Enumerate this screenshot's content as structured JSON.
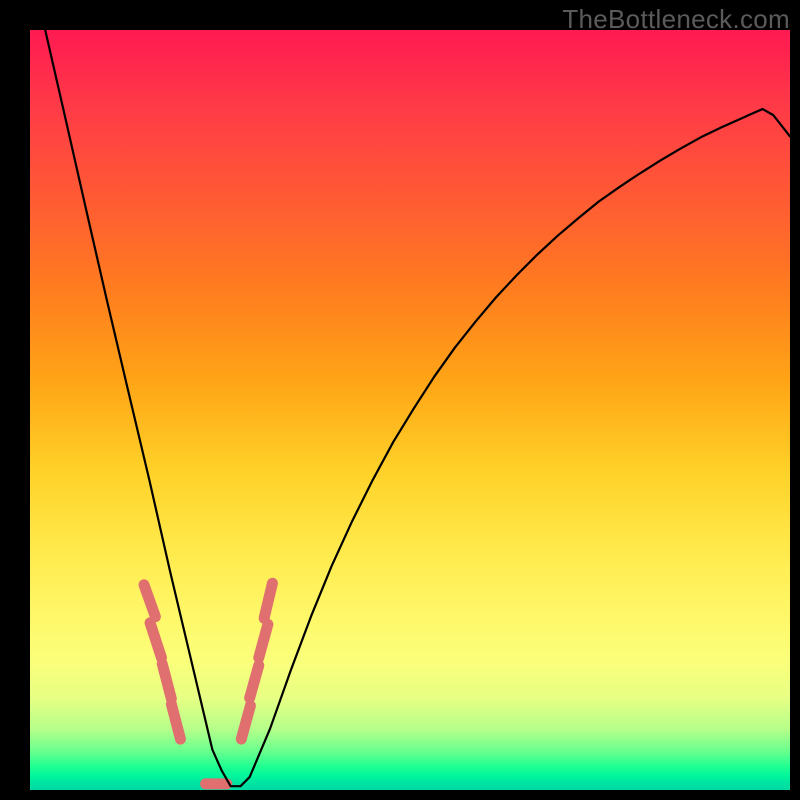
{
  "watermark": "TheBottleneck.com",
  "chart_data": {
    "type": "line",
    "title": "",
    "xlabel": "",
    "ylabel": "",
    "xlim": [
      0,
      100
    ],
    "ylim": [
      0,
      100
    ],
    "grid": false,
    "series": [
      {
        "name": "curve",
        "x": [
          2.0,
          4.7,
          7.4,
          10.1,
          12.9,
          15.7,
          18.4,
          19.8,
          21.2,
          22.6,
          24.0,
          25.2,
          26.4,
          27.7,
          28.9,
          31.6,
          34.3,
          37.0,
          39.7,
          42.4,
          45.1,
          47.8,
          50.5,
          53.2,
          55.9,
          58.6,
          61.3,
          64.0,
          66.7,
          69.4,
          72.1,
          74.8,
          77.5,
          80.2,
          82.9,
          85.6,
          88.3,
          91.0,
          93.7,
          95.0,
          96.4,
          97.8,
          100.0
        ],
        "y": [
          100.0,
          88.2,
          76.3,
          64.5,
          52.6,
          40.8,
          28.9,
          23.0,
          17.1,
          11.2,
          5.3,
          2.6,
          0.5,
          0.5,
          1.7,
          8.1,
          15.7,
          22.9,
          29.5,
          35.4,
          40.8,
          45.8,
          50.2,
          54.4,
          58.2,
          61.6,
          64.8,
          67.7,
          70.4,
          72.9,
          75.2,
          77.4,
          79.3,
          81.1,
          82.8,
          84.4,
          85.9,
          87.2,
          88.4,
          89.0,
          89.6,
          88.8,
          86.0
        ]
      }
    ],
    "markers": {
      "name": "dashed-highlights",
      "x": [
        15.0,
        16.5,
        15.8,
        17.3,
        17.4,
        18.6,
        18.6,
        19.8,
        23.1,
        25.9,
        27.8,
        29.0,
        28.9,
        30.1,
        30.1,
        31.3,
        30.8,
        31.9
      ],
      "y": [
        27.0,
        22.8,
        22.0,
        17.4,
        16.6,
        12.0,
        11.3,
        6.7,
        0.8,
        0.8,
        6.7,
        11.1,
        12.1,
        16.4,
        17.4,
        21.8,
        22.6,
        27.2
      ]
    },
    "gradient_stops": [
      {
        "pos": 0.0,
        "color": "#ff1a52"
      },
      {
        "pos": 0.1,
        "color": "#ff3a47"
      },
      {
        "pos": 0.22,
        "color": "#ff5a34"
      },
      {
        "pos": 0.34,
        "color": "#ff7c1f"
      },
      {
        "pos": 0.46,
        "color": "#ffa416"
      },
      {
        "pos": 0.58,
        "color": "#ffd128"
      },
      {
        "pos": 0.68,
        "color": "#ffe94a"
      },
      {
        "pos": 0.76,
        "color": "#fff666"
      },
      {
        "pos": 0.83,
        "color": "#fbff7a"
      },
      {
        "pos": 0.88,
        "color": "#e6ff84"
      },
      {
        "pos": 0.92,
        "color": "#b5ff8a"
      },
      {
        "pos": 0.95,
        "color": "#66ff8e"
      },
      {
        "pos": 0.97,
        "color": "#1dff92"
      },
      {
        "pos": 0.982,
        "color": "#00f59c"
      },
      {
        "pos": 0.99,
        "color": "#00e4a1"
      },
      {
        "pos": 1.0,
        "color": "#00d9a3"
      }
    ],
    "curve_stroke": "#000000",
    "marker_stroke": "#e07070",
    "marker_width": 11
  }
}
